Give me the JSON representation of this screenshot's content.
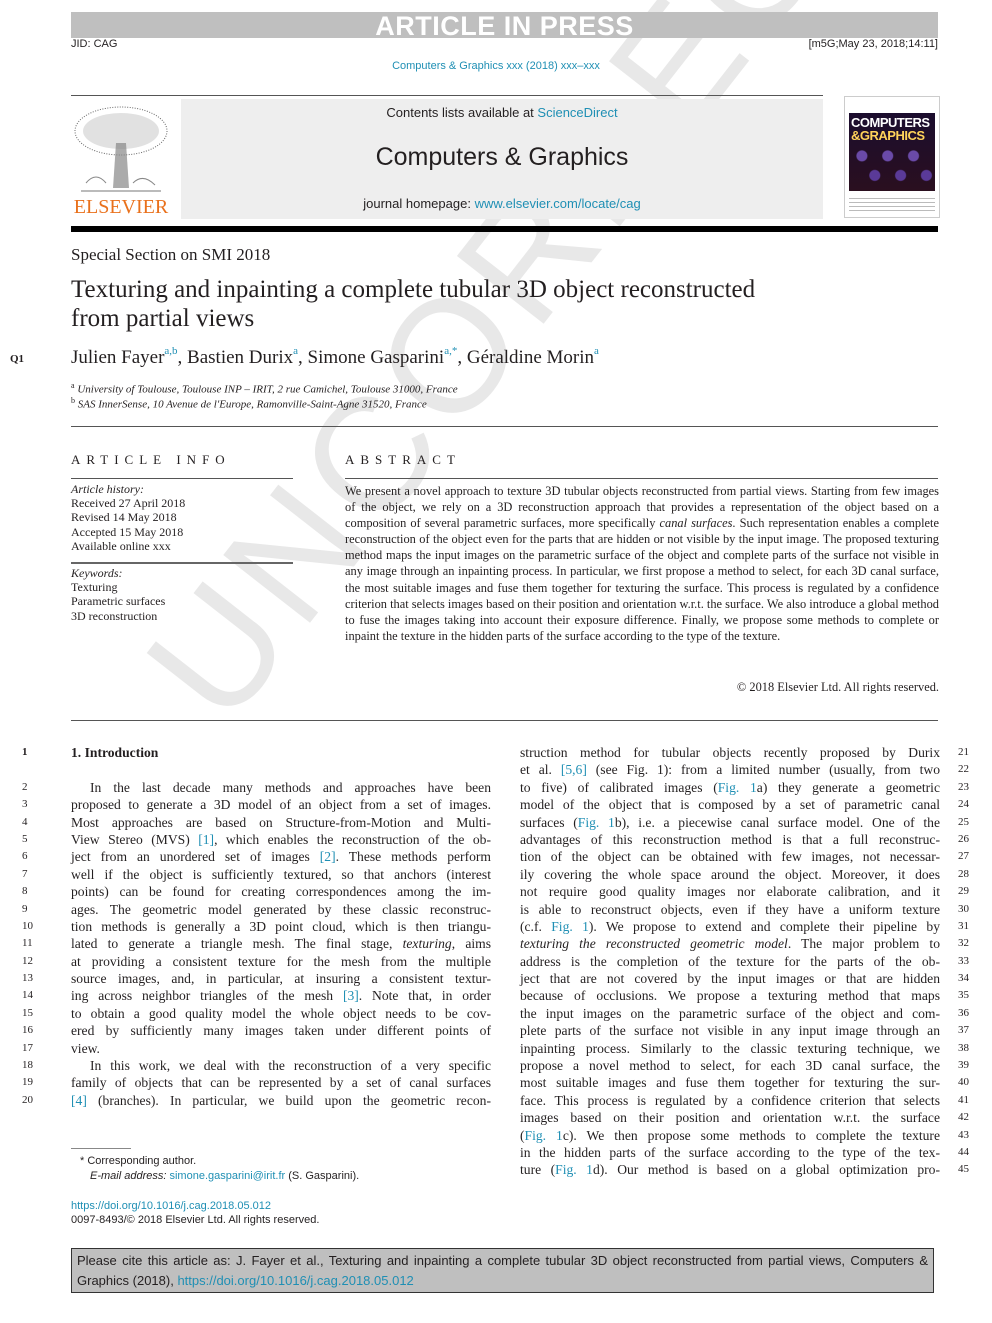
{
  "banner": {
    "text": "ARTICLE IN PRESS",
    "jid": "JID: CAG",
    "stamp": "[m5G;May 23, 2018;14:11]"
  },
  "running_head": "Computers & Graphics xxx (2018) xxx–xxx",
  "masthead": {
    "publisher_logo_text": "ELSEVIER",
    "contents_prefix": "Contents lists available at ",
    "contents_link": "ScienceDirect",
    "journal_title": "Computers & Graphics",
    "homepage_prefix": "journal homepage: ",
    "homepage_link": "www.elsevier.com/locate/cag",
    "cover_title_line1": "COMPUTERS",
    "cover_title_line2": "&GRAPHICS"
  },
  "article": {
    "section": "Special Section on SMI 2018",
    "title_line1": "Texturing and inpainting a complete tubular 3D object reconstructed",
    "title_line2": "from partial views",
    "query_marker": "Q1",
    "authors": [
      {
        "name": "Julien Fayer",
        "sup": "a,b"
      },
      {
        "name": "Bastien Durix",
        "sup": "a"
      },
      {
        "name": "Simone Gasparini",
        "sup": "a,*"
      },
      {
        "name": "Géraldine Morin",
        "sup": "a"
      }
    ],
    "affiliations": [
      {
        "mark": "a",
        "text": "University of Toulouse, Toulouse INP – IRIT, 2 rue Camichel, Toulouse 31000, France"
      },
      {
        "mark": "b",
        "text": "SAS InnerSense, 10 Avenue de l'Europe, Ramonville-Saint-Agne 31520, France"
      }
    ]
  },
  "article_info": {
    "label": "ARTICLE INFO",
    "history_label": "Article history:",
    "history": [
      "Received 27 April 2018",
      "Revised 14 May 2018",
      "Accepted 15 May 2018",
      "Available online xxx"
    ],
    "keywords_label": "Keywords:",
    "keywords": [
      "Texturing",
      "Parametric surfaces",
      "3D reconstruction"
    ]
  },
  "abstract": {
    "label": "ABSTRACT",
    "p1": "We present a novel approach to texture 3D tubular objects reconstructed from partial views. Starting from few images of the object, we rely on a 3D reconstruction approach that provides a representation of the object based on a composition of several parametric surfaces, more specifically ",
    "p1_italic": "canal surfaces",
    "p2": ". Such representation enables a complete reconstruction of the object even for the parts that are hidden or not visible by the input image. The proposed texturing method maps the input images on the parametric surface of the object and complete parts of the surface not visible in any image through an inpainting process. In particular, we first propose a method to select, for each 3D canal surface, the most suitable images and fuse them together for texturing the surface. This process is regulated by a confidence criterion that selects images based on their position and orientation w.r.t. the surface. We also introduce a global method to fuse the images taking into account their exposure difference. Finally, we propose some methods to complete or inpaint the texture in the hidden parts of the surface according to the type of the texture.",
    "copyright": "© 2018 Elsevier Ltd. All rights reserved."
  },
  "body": {
    "left": [
      {
        "n": "1",
        "text": "1. Introduction",
        "type": "heading"
      },
      {
        "n": "",
        "text": "",
        "type": "blank"
      },
      {
        "n": "2",
        "text": "In the last decade many methods and approaches have been",
        "type": "indent"
      },
      {
        "n": "3",
        "text": "proposed to generate a 3D model of an object from a set of images."
      },
      {
        "n": "4",
        "text": "Most approaches are based on Structure-from-Motion and Multi-"
      },
      {
        "n": "5",
        "pre": "View Stereo (MVS) ",
        "link": "[1]",
        "post": ", which enables the reconstruction of the ob-"
      },
      {
        "n": "6",
        "pre": "ject from an unordered set of images ",
        "link": "[2]",
        "post": ". These methods perform"
      },
      {
        "n": "7",
        "text": "well if the object is sufficiently textured, so that anchors (interest"
      },
      {
        "n": "8",
        "text": "points) can be found for creating correspondences among the im-"
      },
      {
        "n": "9",
        "text": "ages. The geometric model generated by these classic reconstruc-"
      },
      {
        "n": "10",
        "text": "tion methods is generally a 3D point cloud, which is then triangu-"
      },
      {
        "n": "11",
        "pre": "lated to generate a triangle mesh. The final stage, ",
        "ital": "texturing",
        "post": ", aims"
      },
      {
        "n": "12",
        "text": "at providing a consistent texture for the mesh from the multiple"
      },
      {
        "n": "13",
        "text": "source images, and, in particular, at insuring a consistent textur-"
      },
      {
        "n": "14",
        "pre": "ing across neighbor triangles of the mesh ",
        "link": "[3]",
        "post": ". Note that, in order"
      },
      {
        "n": "15",
        "text": "to obtain a good quality model the whole object needs to be cov-"
      },
      {
        "n": "16",
        "text": "ered by sufficiently many images taken under different points of"
      },
      {
        "n": "17",
        "text": "view.",
        "type": "last"
      },
      {
        "n": "18",
        "text": "In this work, we deal with the reconstruction of a very specific",
        "type": "indent"
      },
      {
        "n": "19",
        "text": "family of objects that can be represented by a set of canal surfaces"
      },
      {
        "n": "20",
        "pre": "",
        "link": "[4]",
        "post": " (branches). In particular, we build upon the geometric recon-"
      }
    ],
    "right": [
      {
        "n": "21",
        "text": "struction method for tubular objects recently proposed by Durix"
      },
      {
        "n": "22",
        "pre": "et al. ",
        "link": "[5,6]",
        "post": " (see Fig. 1): from a limited number (usually, from two"
      },
      {
        "n": "23",
        "pre": "to five) of calibrated images (",
        "link": "Fig. 1",
        "post": "a) they generate a geometric"
      },
      {
        "n": "24",
        "text": "model of the object that is composed by a set of parametric canal"
      },
      {
        "n": "25",
        "pre": "surfaces (",
        "link": "Fig. 1",
        "post": "b), i.e. a piecewise canal surface model. One of the"
      },
      {
        "n": "26",
        "text": "advantages of this reconstruction method is that a full reconstruc-"
      },
      {
        "n": "27",
        "text": "tion of the object can be obtained with few images, not necessar-"
      },
      {
        "n": "28",
        "text": "ily covering the whole space around the object. Moreover, it does"
      },
      {
        "n": "29",
        "text": "not require good quality images nor elaborate calibration, and it"
      },
      {
        "n": "30",
        "text": "is able to reconstruct objects, even if they have a uniform texture"
      },
      {
        "n": "31",
        "pre": "(c.f. ",
        "link": "Fig. 1",
        "post": "). We propose to extend and complete their pipeline by"
      },
      {
        "n": "32",
        "pre": "",
        "ital": "texturing the reconstructed geometric model",
        "post": ". The major problem to"
      },
      {
        "n": "33",
        "text": "address is the completion of the texture for the parts of the ob-"
      },
      {
        "n": "34",
        "text": "ject that are not covered by the input images or that are hidden"
      },
      {
        "n": "35",
        "text": "because of occlusions. We propose a texturing method that maps"
      },
      {
        "n": "36",
        "text": "the input images on the parametric surface of the object and com-"
      },
      {
        "n": "37",
        "text": "plete parts of the surface not visible in any input image through an"
      },
      {
        "n": "38",
        "text": "inpainting process. Similarly to the classic texturing technique, we"
      },
      {
        "n": "39",
        "text": "propose a novel method to select, for each 3D canal surface, the"
      },
      {
        "n": "40",
        "text": "most suitable images and fuse them together for texturing the sur-"
      },
      {
        "n": "41",
        "text": "face. This process is regulated by a confidence criterion that selects"
      },
      {
        "n": "42",
        "text": "images based on their position and orientation w.r.t. the surface"
      },
      {
        "n": "43",
        "pre": "(",
        "link": "Fig. 1",
        "post": "c). We then propose some methods to complete the texture"
      },
      {
        "n": "44",
        "text": "in the hidden parts of the surface according to the type of the tex-"
      },
      {
        "n": "45",
        "pre": "ture (",
        "link": "Fig. 1",
        "post": "d). Our method is based on a global optimization pro-"
      }
    ]
  },
  "footnotes": {
    "corresponding": "* Corresponding author.",
    "email_label": "E-mail address: ",
    "email": "simone.gasparini@irit.fr",
    "email_suffix": " (S. Gasparini).",
    "doi": "https://doi.org/10.1016/j.cag.2018.05.012",
    "issn": "0097-8493/© 2018 Elsevier Ltd. All rights reserved."
  },
  "cite_box": {
    "text": "Please cite this article as: J. Fayer et al., Texturing and inpainting a complete tubular 3D object reconstructed from partial views, Computers & Graphics (2018), ",
    "link": "https://doi.org/10.1016/j.cag.2018.05.012"
  },
  "watermark": "UNCORRECTED PROOF",
  "colors": {
    "link": "#1f8fb4",
    "elsevier_orange": "#e9711c",
    "banner_gray": "#bfbfbf"
  }
}
